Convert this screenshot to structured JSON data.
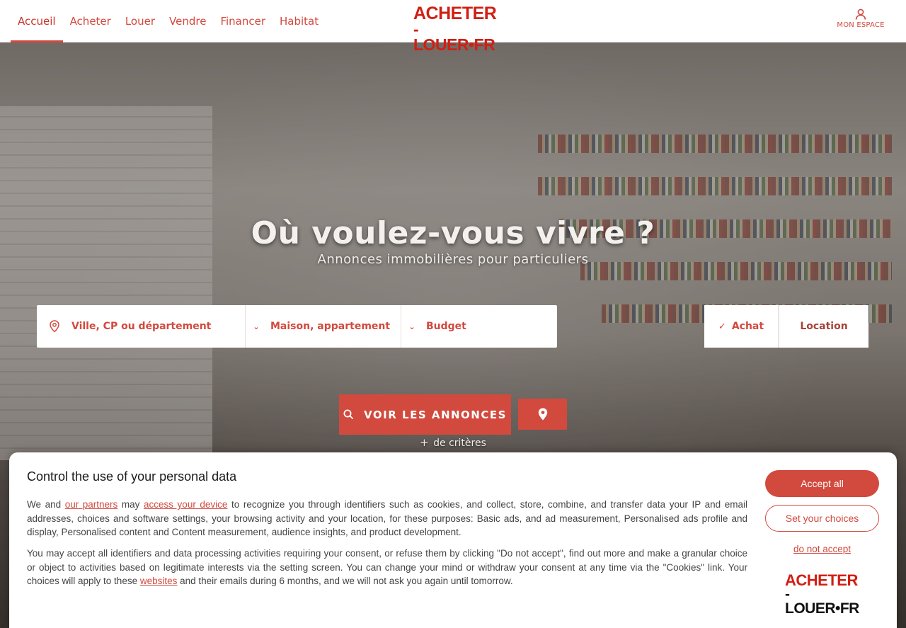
{
  "header": {
    "nav": [
      {
        "label": "Accueil",
        "active": true
      },
      {
        "label": "Acheter"
      },
      {
        "label": "Louer"
      },
      {
        "label": "Vendre"
      },
      {
        "label": "Financer"
      },
      {
        "label": "Habitat"
      }
    ],
    "logo_line1": "ACHETER",
    "logo_line2": "-LOUER•FR",
    "account_label": "MON ESPACE"
  },
  "hero": {
    "title": "Où voulez-vous vivre ?",
    "subtitle": "Annonces immobilières pour particuliers",
    "search": {
      "location_label": "Ville, CP ou département",
      "type_label": "Maison, appartement",
      "budget_label": "Budget"
    },
    "toggle": {
      "achat_label": "Achat",
      "location_label": "Location",
      "selected": "Achat"
    },
    "cta_label": "VOIR LES ANNONCES",
    "more_criteria": "de critères"
  },
  "consent": {
    "title": "Control the use of your personal data",
    "p1_a": "We and ",
    "p1_link1": "our partners",
    "p1_b": " may ",
    "p1_link2": "access your device",
    "p1_c": " to recognize you through identifiers such as cookies, and collect, store, combine, and transfer data your IP and email addresses, choices and software settings, your browsing activity and your location, for these purposes: Basic ads, and ad measurement, Personalised ads profile and display, Personalised content and Content measurement, audience insights, and product development.",
    "p2_a": "You may accept all identifiers and data processing activities requiring your consent, or refuse them by clicking \"Do not accept\", find out more and make a granular choice or object to activities based on legitimate interests via the setting screen. You can change your mind or withdraw your consent at any time via the \"Cookies\" link. Your choices will apply to these ",
    "p2_link": "websites",
    "p2_b": " and their emails during 6 months, and we will not ask you again until tomorrow.",
    "accept_label": "Accept all",
    "choices_label": "Set your choices",
    "deny_label": "do not accept",
    "logo_line1": "ACHETER",
    "logo_line2": "-LOUER•FR"
  },
  "colors": {
    "accent": "#d2493e",
    "logo_red": "#d11f14"
  }
}
